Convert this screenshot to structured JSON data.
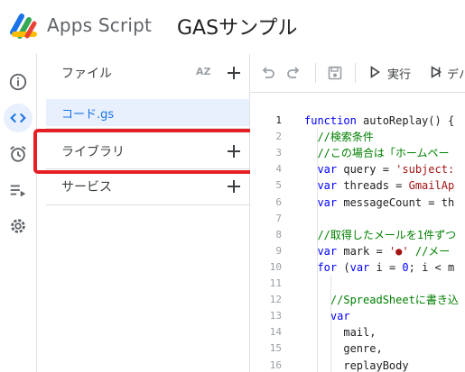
{
  "header": {
    "app_name": "Apps Script",
    "project_title": "GASサンプル"
  },
  "rail": {
    "icons": [
      "info-icon",
      "code-icon",
      "alarm-icon",
      "executions-icon",
      "gear-icon"
    ]
  },
  "panel": {
    "files_label": "ファイル",
    "sort_label": "AZ",
    "file_name": "コード.gs",
    "library_label": "ライブラリ",
    "services_label": "サービス"
  },
  "toolbar": {
    "run_label": "実行",
    "debug_label": "デバ"
  },
  "code": {
    "lines": [
      {
        "n": "1",
        "parts": [
          {
            "t": "function ",
            "c": "kw"
          },
          {
            "t": "autoReplay() {",
            "c": ""
          }
        ]
      },
      {
        "n": "2",
        "parts": [
          {
            "t": "  //検索条件",
            "c": "cm"
          }
        ]
      },
      {
        "n": "3",
        "parts": [
          {
            "t": "  //この場合は「ホームペー",
            "c": "cm"
          }
        ]
      },
      {
        "n": "4",
        "parts": [
          {
            "t": "  var ",
            "c": "kw"
          },
          {
            "t": "query = ",
            "c": ""
          },
          {
            "t": "'subject:",
            "c": "str"
          }
        ]
      },
      {
        "n": "5",
        "parts": [
          {
            "t": "  var ",
            "c": "kw"
          },
          {
            "t": "threads = ",
            "c": ""
          },
          {
            "t": "GmailAp",
            "c": "str"
          }
        ]
      },
      {
        "n": "6",
        "parts": [
          {
            "t": "  var ",
            "c": "kw"
          },
          {
            "t": "messageCount = th",
            "c": ""
          }
        ]
      },
      {
        "n": "7",
        "parts": []
      },
      {
        "n": "8",
        "parts": [
          {
            "t": "  //取得したメールを1件ずつ",
            "c": "cm"
          }
        ]
      },
      {
        "n": "9",
        "parts": [
          {
            "t": "  var ",
            "c": "kw"
          },
          {
            "t": "mark = ",
            "c": ""
          },
          {
            "t": "'●'",
            "c": "str"
          },
          {
            "t": " //メー",
            "c": "cm"
          }
        ]
      },
      {
        "n": "10",
        "parts": [
          {
            "t": "  for ",
            "c": "kw"
          },
          {
            "t": "(",
            "c": ""
          },
          {
            "t": "var ",
            "c": "kw"
          },
          {
            "t": "i = ",
            "c": ""
          },
          {
            "t": "0",
            "c": "kw"
          },
          {
            "t": "; i < m",
            "c": ""
          }
        ]
      },
      {
        "n": "11",
        "parts": []
      },
      {
        "n": "12",
        "parts": [
          {
            "t": "    //SpreadSheetに書き込",
            "c": "cm"
          }
        ]
      },
      {
        "n": "13",
        "parts": [
          {
            "t": "    var",
            "c": "kw"
          }
        ]
      },
      {
        "n": "14",
        "parts": [
          {
            "t": "      mail,",
            "c": ""
          }
        ]
      },
      {
        "n": "15",
        "parts": [
          {
            "t": "      genre,",
            "c": ""
          }
        ]
      },
      {
        "n": "16",
        "parts": [
          {
            "t": "      replayBody",
            "c": ""
          }
        ]
      }
    ]
  }
}
